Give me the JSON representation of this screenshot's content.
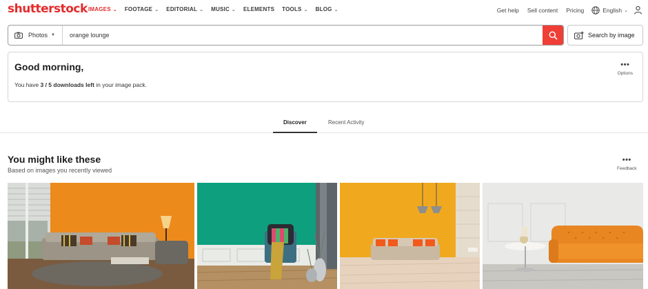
{
  "brand": {
    "logo": "shutterstock",
    "color": "#e32b2b"
  },
  "nav": {
    "items": [
      {
        "label": "IMAGES",
        "active": true,
        "dropdown": true
      },
      {
        "label": "FOOTAGE",
        "dropdown": true
      },
      {
        "label": "EDITORIAL",
        "dropdown": true
      },
      {
        "label": "MUSIC",
        "dropdown": true
      },
      {
        "label": "ELEMENTS",
        "dropdown": false
      },
      {
        "label": "TOOLS",
        "dropdown": true
      },
      {
        "label": "BLOG",
        "dropdown": true
      }
    ],
    "right": {
      "help": "Get help",
      "sell": "Sell content",
      "pricing": "Pricing",
      "language": "English"
    }
  },
  "search": {
    "type": "Photos",
    "query": "orange lounge",
    "by_image": "Search by image",
    "button_color": "#ef3e36"
  },
  "greeting": {
    "title": "Good morning,",
    "downloads_prefix": "You have ",
    "downloads_count": "3 / 5 downloads left",
    "downloads_suffix": " in your image pack.",
    "options_label": "Options"
  },
  "tabs": [
    {
      "label": "Discover",
      "active": true
    },
    {
      "label": "Recent Activity",
      "active": false
    }
  ],
  "recommend": {
    "title": "You might like these",
    "subtitle": "Based on images you recently viewed",
    "feedback_label": "Feedback",
    "images": [
      {
        "subject": "orange living room with sofa and lamp"
      },
      {
        "subject": "green wall with armchair and vases"
      },
      {
        "subject": "orange wall with sofa and pendant lamps"
      },
      {
        "subject": "orange tufted sofa with table"
      }
    ]
  }
}
